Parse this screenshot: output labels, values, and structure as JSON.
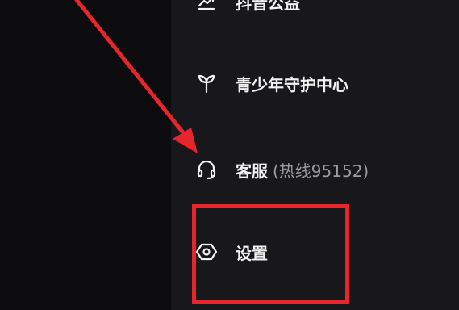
{
  "menu": {
    "items": [
      {
        "label": "抖音公益",
        "icon": "charity-icon"
      },
      {
        "label": "青少年守护中心",
        "icon": "sprout-icon"
      },
      {
        "label": "客服",
        "sub": "(热线95152)",
        "icon": "headset-icon"
      },
      {
        "label": "设置",
        "icon": "hexagon-settings-icon"
      }
    ]
  },
  "annotations": {
    "arrow_color": "#e6262c",
    "box_color": "#e6262c"
  }
}
